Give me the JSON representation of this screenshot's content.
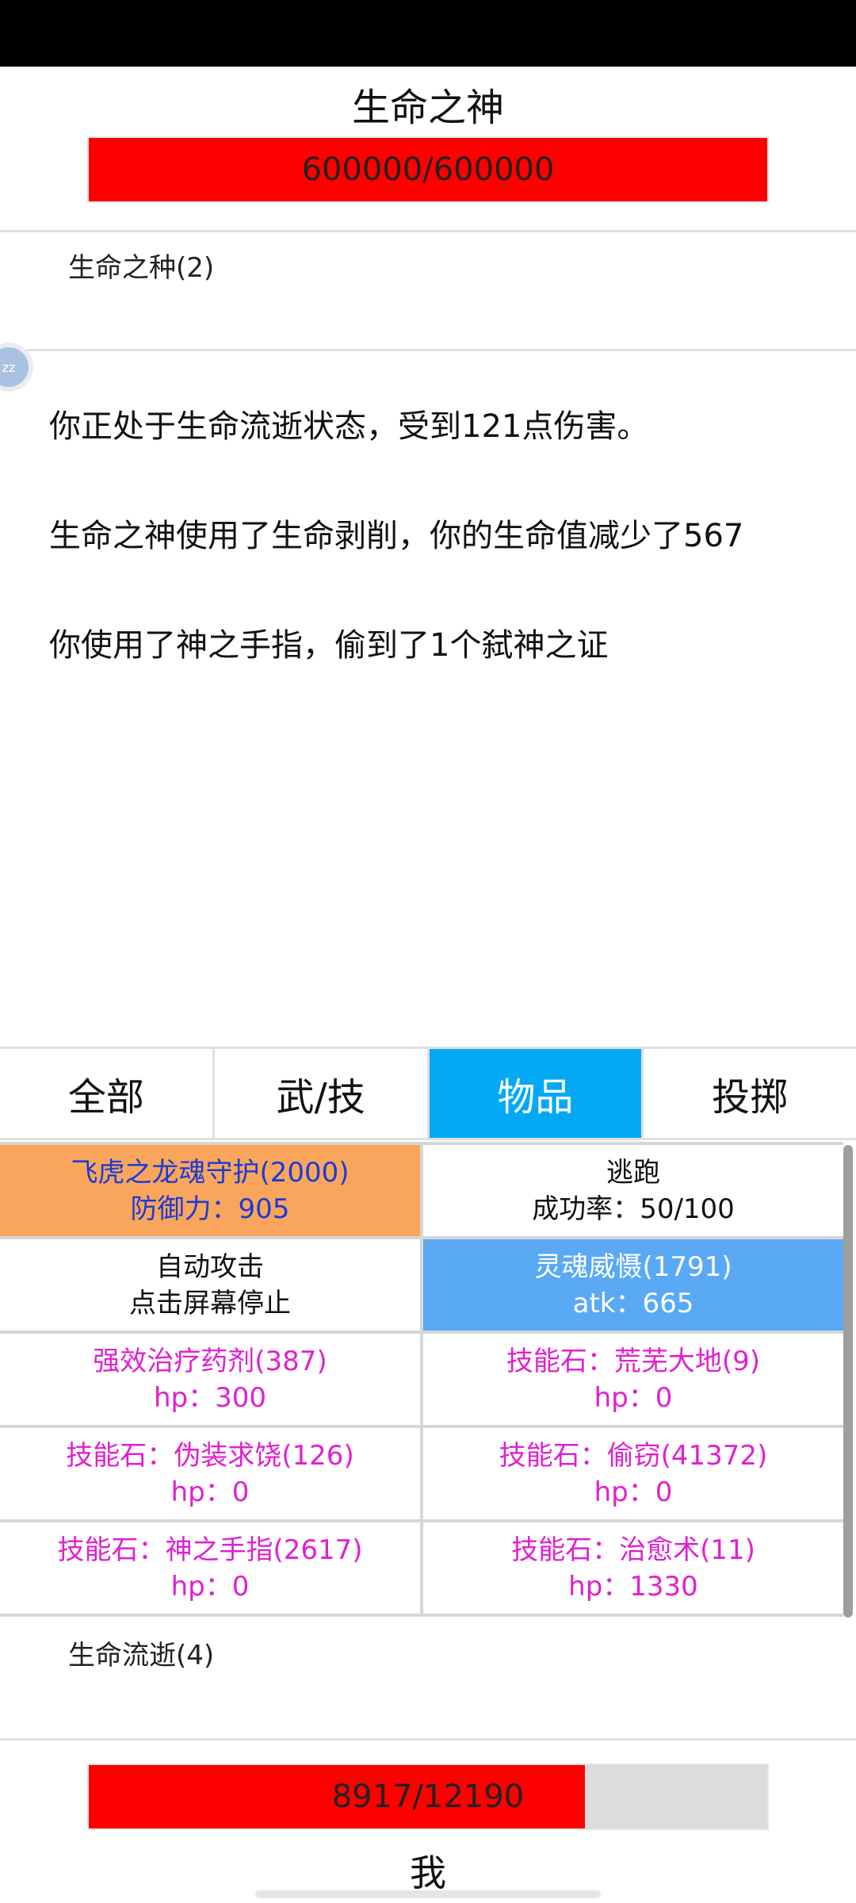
{
  "enemy": {
    "name": "生命之神",
    "hp_text": "600000/600000",
    "hp_fraction": 1.0,
    "buff": "生命之种(2)"
  },
  "log": [
    "你正处于生命流逝状态，受到121点伤害。",
    "生命之神使用了生命剥削，你的生命值减少了567",
    "你使用了神之手指，偷到了1个弑神之证"
  ],
  "float_button": {
    "label": "zz"
  },
  "tabs": [
    "全部",
    "武/技",
    "物品",
    "投掷"
  ],
  "active_tab": "物品",
  "skills": [
    {
      "name": "飞虎之龙魂守护(2000)",
      "stat": "防御力：905",
      "style": "orange"
    },
    {
      "name": "逃跑",
      "stat": "成功率：50/100",
      "style": "plain"
    },
    {
      "name": "自动攻击",
      "stat": "点击屏幕停止",
      "style": "plain"
    },
    {
      "name": "灵魂威慑(1791)",
      "stat": "atk：665",
      "style": "blue"
    },
    {
      "name": "强效治疗药剂(387)",
      "stat": "hp：300",
      "style": "magenta"
    },
    {
      "name": "技能石：荒芜大地(9)",
      "stat": "hp：0",
      "style": "magenta"
    },
    {
      "name": "技能石：伪装求饶(126)",
      "stat": "hp：0",
      "style": "magenta"
    },
    {
      "name": "技能石：偷窃(41372)",
      "stat": "hp：0",
      "style": "magenta"
    },
    {
      "name": "技能石：神之手指(2617)",
      "stat": "hp：0",
      "style": "magenta"
    },
    {
      "name": "技能石：治愈术(11)",
      "stat": "hp：1330",
      "style": "magenta"
    }
  ],
  "player": {
    "name": "我",
    "hp_text": "8917/12190",
    "hp_fraction": 0.7315,
    "buff": "生命流逝(4)"
  },
  "colors": {
    "hp_fill": "#ff0000",
    "hp_empty": "#dcdcdc",
    "tab_active": "#03a9f4",
    "skill_orange": "#f9a55c",
    "skill_blue": "#5aa9f5",
    "skill_magenta": "#e020d0"
  }
}
